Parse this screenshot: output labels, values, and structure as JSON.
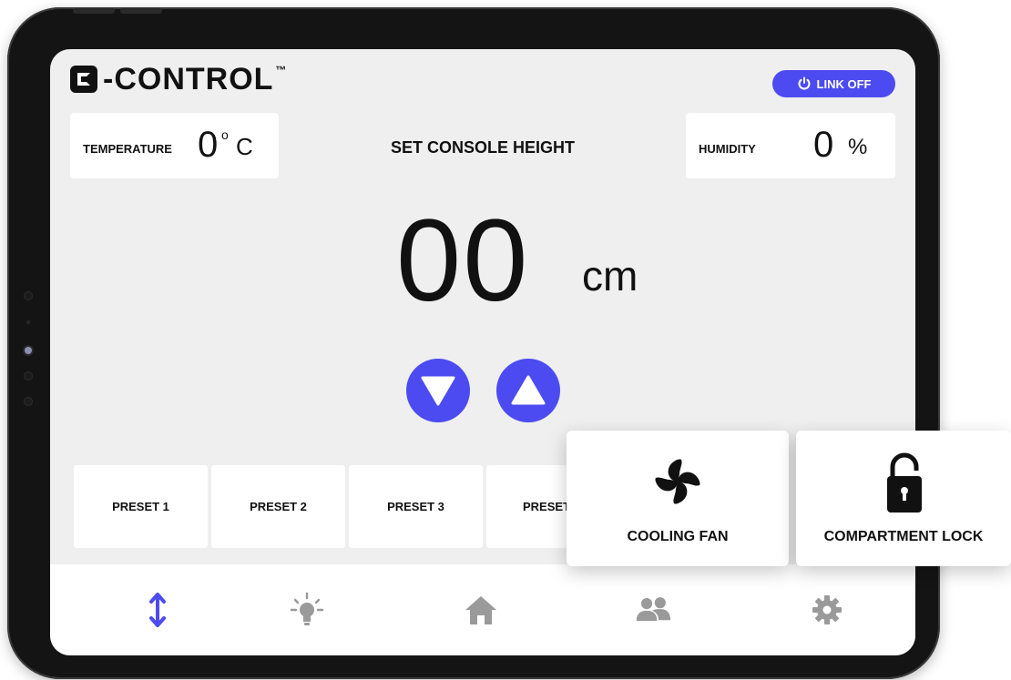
{
  "app": {
    "logo_text": "-CONTROL",
    "logo_tm": "™"
  },
  "header": {
    "link_label": "LINK OFF",
    "link_icon": "power-icon"
  },
  "temperature": {
    "label": "TEMPERATURE",
    "value": "0",
    "degree": "o",
    "unit": "C"
  },
  "humidity": {
    "label": "HUMIDITY",
    "value": "0",
    "unit": "%"
  },
  "console": {
    "title": "SET CONSOLE HEIGHT",
    "height_value": "00",
    "height_unit": "cm"
  },
  "presets": [
    {
      "label": "PRESET 1"
    },
    {
      "label": "PRESET 2"
    },
    {
      "label": "PRESET 3"
    },
    {
      "label": "PRESET"
    }
  ],
  "popups": {
    "fan_label": "COOLING FAN",
    "lock_label": "COMPARTMENT LOCK"
  },
  "nav": {
    "items": [
      {
        "icon": "height-arrows-icon",
        "active": true
      },
      {
        "icon": "light-bulb-icon",
        "active": false
      },
      {
        "icon": "home-icon",
        "active": false
      },
      {
        "icon": "users-icon",
        "active": false
      },
      {
        "icon": "gear-icon",
        "active": false
      }
    ]
  },
  "colors": {
    "accent": "#4c4bf2",
    "inactive_icon": "#9a9a9a",
    "screen_bg": "#efefef"
  }
}
